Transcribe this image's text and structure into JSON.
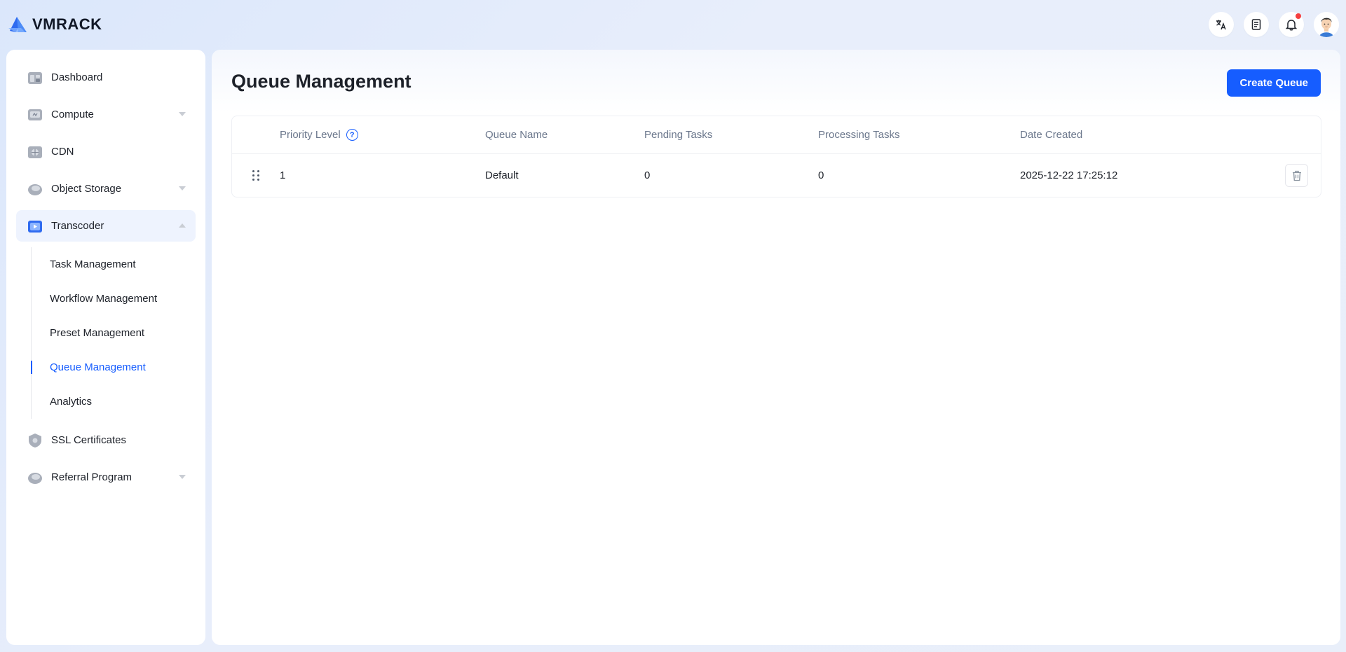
{
  "brand": {
    "name": "VMRACK",
    "accent": "#165dff"
  },
  "header": {
    "icons": [
      "translate-icon",
      "document-icon",
      "bell-icon"
    ],
    "notification_dot_color": "#f53f3f"
  },
  "sidebar": {
    "items": [
      {
        "label": "Dashboard",
        "icon": "dashboard-icon"
      },
      {
        "label": "Compute",
        "icon": "compute-icon",
        "expandable": true
      },
      {
        "label": "CDN",
        "icon": "cdn-icon"
      },
      {
        "label": "Object Storage",
        "icon": "object-storage-icon",
        "expandable": true
      },
      {
        "label": "Transcoder",
        "icon": "transcoder-icon",
        "expanded": true
      },
      {
        "label": "SSL Certificates",
        "icon": "ssl-icon"
      },
      {
        "label": "Referral Program",
        "icon": "referral-icon",
        "expandable": true
      }
    ],
    "transcoder_sub": [
      {
        "label": "Task Management"
      },
      {
        "label": "Workflow Management"
      },
      {
        "label": "Preset Management"
      },
      {
        "label": "Queue Management",
        "active": true
      },
      {
        "label": "Analytics"
      }
    ]
  },
  "main": {
    "title": "Queue Management",
    "create_button": "Create Queue",
    "table": {
      "headers": {
        "priority": "Priority Level",
        "name": "Queue Name",
        "pending": "Pending Tasks",
        "processing": "Processing Tasks",
        "date": "Date Created"
      },
      "help_glyph": "?",
      "rows": [
        {
          "priority": "1",
          "name": "Default",
          "pending": "0",
          "processing": "0",
          "date": "2025-12-22 17:25:12"
        }
      ]
    }
  }
}
